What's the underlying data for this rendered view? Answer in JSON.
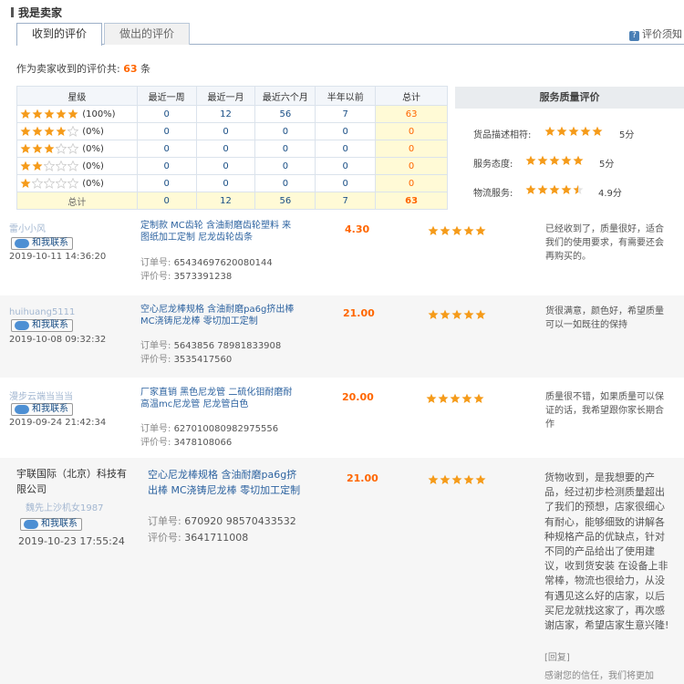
{
  "page_title": "我是卖家",
  "tabs": [
    {
      "label": "收到的评价"
    },
    {
      "label": "做出的评价"
    }
  ],
  "help_link": "评价须知",
  "total": {
    "prefix": "作为卖家收到的评价共:",
    "count": "63",
    "suffix": "条"
  },
  "summary": {
    "headers": [
      "星级",
      "最近一周",
      "最近一月",
      "最近六个月",
      "半年以前",
      "总计"
    ],
    "rows": [
      {
        "stars": 5,
        "pct": "(100%)",
        "week": "0",
        "month": "12",
        "six": "56",
        "older": "7",
        "total": "63"
      },
      {
        "stars": 4,
        "pct": "(0%)",
        "week": "0",
        "month": "0",
        "six": "0",
        "older": "0",
        "total": "0"
      },
      {
        "stars": 3,
        "pct": "(0%)",
        "week": "0",
        "month": "0",
        "six": "0",
        "older": "0",
        "total": "0"
      },
      {
        "stars": 2,
        "pct": "(0%)",
        "week": "0",
        "month": "0",
        "six": "0",
        "older": "0",
        "total": "0"
      },
      {
        "stars": 1,
        "pct": "(0%)",
        "week": "0",
        "month": "0",
        "six": "0",
        "older": "0",
        "total": "0"
      }
    ],
    "sum_row": {
      "label": "总计",
      "week": "0",
      "month": "12",
      "six": "56",
      "older": "7",
      "total": "63"
    }
  },
  "quality": {
    "title": "服务质量评价",
    "items": [
      {
        "label": "货品描述相符:",
        "rating": 5,
        "score": "5分"
      },
      {
        "label": "服务态度:",
        "rating": 5,
        "score": "5分"
      },
      {
        "label": "物流服务:",
        "rating": 4.5,
        "score": "4.9分"
      }
    ]
  },
  "reviews": [
    {
      "buyer": "雷小小风",
      "contact": "和我联系",
      "date": "2019-10-11 14:36:20",
      "title": "定制款 MC齿轮 含油耐磨齿轮塑料 来图纸加工定制 尼龙齿轮齿条",
      "order_label": "订单号:",
      "order_no": "65434697620080144",
      "eval_label": "评价号:",
      "eval_no": "3573391238",
      "price": "4.30",
      "stars": 5,
      "comment": "已经收到了，质量很好，适合我们的使用要求，有需要还会再购买的。"
    },
    {
      "buyer": "huihuang5111",
      "contact": "和我联系",
      "date": "2019-10-08 09:32:32",
      "title": "空心尼龙棒规格 含油耐磨pa6g挤出棒 MC浇铸尼龙棒 零切加工定制",
      "order_label": "订单号:",
      "order_no": "5643856 78981833908",
      "eval_label": "评价号:",
      "eval_no": "3535417560",
      "price": "21.00",
      "stars": 5,
      "comment": "货很满意，颜色好，希望质量可以一如既往的保持"
    },
    {
      "buyer": "漫步云端当当当",
      "contact": "和我联系",
      "date": "2019-09-24 21:42:34",
      "title": "厂家直销 黑色尼龙管 二硫化钼耐磨耐高温mc尼龙管 尼龙管白色",
      "order_label": "订单号:",
      "order_no": "627010080982975556",
      "eval_label": "评价号:",
      "eval_no": "3478108066",
      "price": "20.00",
      "stars": 5,
      "comment": "质量很不错，如果质量可以保证的话，我希望跟你家长期合作"
    },
    {
      "buyer": "宇联国际（北京）科技有限公司",
      "buyer_sub": "魏先上沙机女1987",
      "contact": "和我联系",
      "date": "2019-10-23 17:55:24",
      "title": "空心尼龙棒规格 含油耐磨pa6g挤出棒 MC浇铸尼龙棒 零切加工定制",
      "order_label": "订单号:",
      "order_no": "670920 98570433532",
      "eval_label": "评价号:",
      "eval_no": "3641711008",
      "price": "21.00",
      "stars": 5,
      "comment": "货物收到，是我想要的产品，经过初步检测质量超出了我们的预想，店家很细心有耐心，能够细致的讲解各种规格产品的优缺点，针对不同的产品给出了使用建议，收到货安装 在设备上非常棒，物流也很给力，从没有遇见这么好的店家，以后买尼龙就找这家了，再次感谢店家，希望店家生意兴隆!",
      "reply_label": "[回复]",
      "reply_text": "感谢您的信任，我们将更加"
    }
  ],
  "colors": {
    "accent": "#ff6600",
    "star": "#f59b1a",
    "link": "#2d63a0"
  }
}
